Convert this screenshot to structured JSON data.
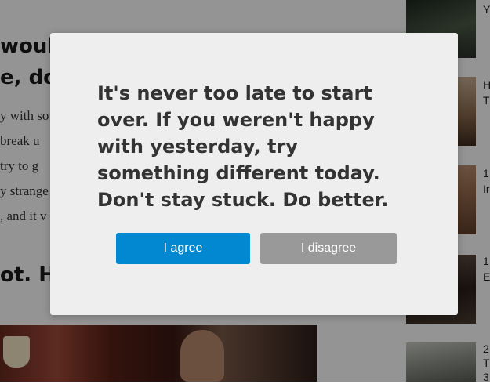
{
  "article": {
    "heading_line1": "would",
    "heading_line2": "e, don",
    "paragraph_lines": [
      "y with so",
      "break u",
      "try to g",
      "y strange",
      ", and it v"
    ],
    "heading2": "ot. Ha"
  },
  "sidebar": {
    "items": [
      {
        "title": "Y"
      },
      {
        "title": "H\nT"
      },
      {
        "title": "1\nIr"
      },
      {
        "title": "1\nE"
      },
      {
        "title": "2\nT\n3"
      }
    ]
  },
  "modal": {
    "message": "It's never too late to start over. If you weren't happy with yesterday, try something different today. Don't stay stuck. Do better.",
    "agree_label": "I agree",
    "disagree_label": "I disagree"
  },
  "colors": {
    "agree": "#0288d1",
    "disagree": "#999999",
    "modal_bg": "#eeeeee",
    "text": "#333333"
  }
}
